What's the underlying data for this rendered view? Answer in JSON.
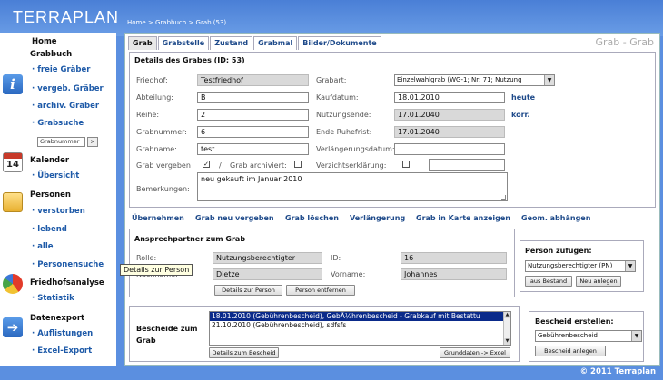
{
  "app": {
    "logo": "TERRAPLAN",
    "footer": "© 2011 Terraplan"
  },
  "breadcrumb": {
    "home": "Home",
    "sep1": " > ",
    "grabbuch": "Grabbuch",
    "sep2": " > ",
    "current": "Grab (53)"
  },
  "sidebar": {
    "home": "Home",
    "grabbuch": "Grabbuch",
    "freie": "· freie Gräber",
    "vergeb": "· vergeb. Gräber",
    "archiv": "· archiv. Gräber",
    "grabsuche": "· Grabsuche",
    "search_value": "Grabnummer",
    "search_go": ">",
    "kalender": "Kalender",
    "uebersicht": "· Übersicht",
    "personen": "Personen",
    "verstorben": "· verstorben",
    "lebend": "· lebend",
    "alle": "· alle",
    "personensuche": "· Personensuche",
    "friedhofsanalyse": "Friedhofsanalyse",
    "statistik": "· Statistik",
    "datenexport": "Datenexport",
    "auflistungen": "· Auflistungen",
    "excel": "· Excel-Export",
    "icons": [
      "info-icon",
      "calendar-icon",
      "folder-icon",
      "pie-chart-icon",
      "arrow-icon"
    ],
    "calendar_day": "14"
  },
  "tabs": [
    "Grab",
    "Grabstelle",
    "Zustand",
    "Grabmal",
    "Bilder/Dokumente"
  ],
  "page_title": "Grab - Grab",
  "details": {
    "title": "Details des Grabes (ID: 53)",
    "friedhof_label": "Friedhof:",
    "friedhof": "Testfriedhof",
    "abteilung_label": "Abteilung:",
    "abteilung": "B",
    "reihe_label": "Reihe:",
    "reihe": "2",
    "grabnummer_label": "Grabnummer:",
    "grabnummer": "6",
    "grabname_label": "Grabname:",
    "grabname": "test",
    "vergeben_label": "Grab vergeben",
    "vergeben_checked": "✓",
    "slash": "/",
    "archiviert_label": "Grab archiviert:",
    "bemerkungen_label": "Bemerkungen:",
    "bemerkungen": "neu gekauft im Januar 2010",
    "grabart_label": "Grabart:",
    "grabart": "Einzelwahlgrab (WG-1; Nr: 71; Nutzung",
    "kaufdatum_label": "Kaufdatum:",
    "kaufdatum": "18.01.2010",
    "heute": "heute",
    "nutzungsende_label": "Nutzungsende:",
    "nutzungsende": "17.01.2040",
    "korr": "korr.",
    "ruhefrist_label": "Ende Ruhefrist:",
    "ruhefrist": "17.01.2040",
    "verlaengerung_label": "Verlängerungsdatum:",
    "verlaengerung": "",
    "verzicht_label": "Verzichtserklärung:",
    "verzicht": ""
  },
  "actions": [
    "Übernehmen",
    "Grab neu vergeben",
    "Grab löschen",
    "Verlängerung",
    "Grab in Karte anzeigen",
    "Geom. abhängen"
  ],
  "contact": {
    "title": "Ansprechpartner zum Grab",
    "rolle_label": "Rolle:",
    "rolle": "Nutzungsberechtigter",
    "id_label": "ID:",
    "id": "16",
    "nachname_label": "Nachname:",
    "nachname": "Dietze",
    "vorname_label": "Vorname:",
    "vorname": "Johannes",
    "details_btn": "Details zur Person",
    "remove_btn": "Person entfernen",
    "tooltip": "Details zur Person"
  },
  "add_person": {
    "title": "Person zufügen:",
    "select": "Nutzungsberechtigter (PN)",
    "from_list_btn": "aus Bestand",
    "new_btn": "Neu anlegen"
  },
  "bescheide": {
    "title_line1": "Bescheide zum",
    "title_line2": "Grab",
    "items": [
      "18.01.2010 (Gebührenbescheid), GebÃ¼hrenbescheid - Grabkauf mit Bestattu",
      "21.10.2010 (Gebührenbescheid), sdfsfs"
    ],
    "details_btn": "Details zum Bescheid",
    "excel_btn": "Grunddaten -> Excel"
  },
  "create_bescheid": {
    "title": "Bescheid erstellen:",
    "select": "Gebührenbescheid",
    "create_btn": "Bescheid anlegen"
  }
}
